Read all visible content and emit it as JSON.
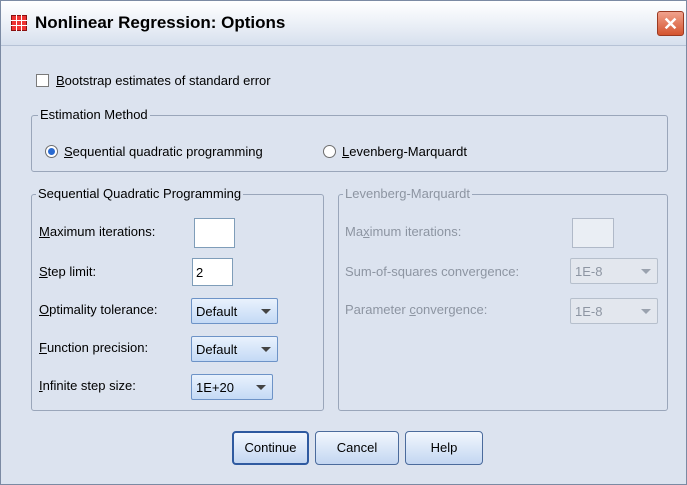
{
  "window": {
    "title": "Nonlinear Regression: Options",
    "close_glyph": "✕"
  },
  "bootstrap": {
    "label_mnemonic": "B",
    "label_rest": "ootstrap estimates of standard error",
    "checked": false
  },
  "estimation": {
    "legend": "Estimation Method",
    "options": [
      {
        "mnemonic": "S",
        "rest": "equential quadratic programming",
        "selected": true
      },
      {
        "mnemonic": "L",
        "rest": "evenberg-Marquardt",
        "selected": false
      }
    ]
  },
  "sqp": {
    "legend": "Sequential Quadratic Programming",
    "max_iter": {
      "pre": "",
      "mnemonic": "M",
      "post": "aximum iterations:",
      "value": ""
    },
    "step_limit": {
      "pre": "",
      "mnemonic": "S",
      "post": "tep limit:",
      "value": "2"
    },
    "optimality": {
      "pre": "",
      "mnemonic": "O",
      "post": "ptimality tolerance:",
      "value": "Default"
    },
    "function_precision": {
      "pre": "",
      "mnemonic": "F",
      "post": "unction precision:",
      "value": "Default"
    },
    "infinite_step": {
      "pre": "",
      "mnemonic": "I",
      "post": "nfinite step size:",
      "value": "1E+20"
    }
  },
  "lm": {
    "legend": "Levenberg-Marquardt",
    "max_iter": {
      "pre": "Ma",
      "mnemonic": "x",
      "post": "imum iterations:",
      "value": ""
    },
    "ss_convergence": {
      "pre": "Sum-of-squares convergence:",
      "value": "1E-8"
    },
    "param_convergence": {
      "pre": "Parameter ",
      "mnemonic": "c",
      "post": "onvergence:",
      "value": "1E-8"
    }
  },
  "buttons": {
    "continue": "Continue",
    "cancel": "Cancel",
    "help": "Help"
  },
  "colors": {
    "dialog_bg": "#dce3ef",
    "accent": "#2f5aa0",
    "close": "#d4542f"
  }
}
